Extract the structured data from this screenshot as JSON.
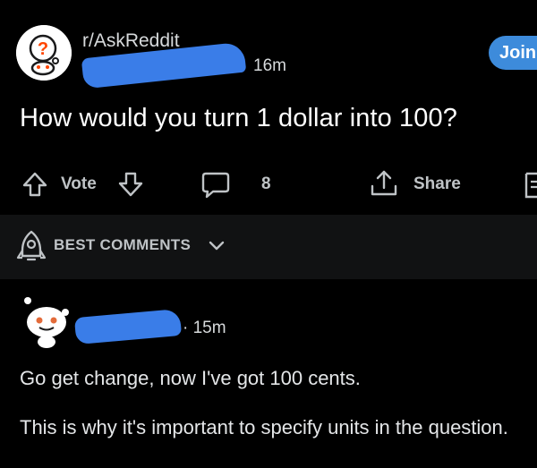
{
  "post": {
    "subreddit": "r/AskReddit",
    "time": "16m",
    "join_label": "Join",
    "title": "How would you turn 1 dollar into 100?"
  },
  "actions": {
    "vote_label": "Vote",
    "comment_count": "8",
    "share_label": "Share"
  },
  "comments_header": {
    "label": "BEST COMMENTS"
  },
  "comment": {
    "time": "· 15m",
    "lines": [
      "Go get change, now I've got 100 cents.",
      "This is why it's important to specify units in the question."
    ]
  },
  "colors": {
    "background": "#000000",
    "accent_join": "#3d8bdb",
    "redaction": "#3a7de8",
    "comments_bar": "#111213"
  },
  "icons": [
    "subreddit-avatar-icon",
    "upvote-icon",
    "downvote-icon",
    "comment-icon",
    "share-icon",
    "save-icon",
    "rocket-icon",
    "chevron-down-icon",
    "user-avatar-icon"
  ]
}
